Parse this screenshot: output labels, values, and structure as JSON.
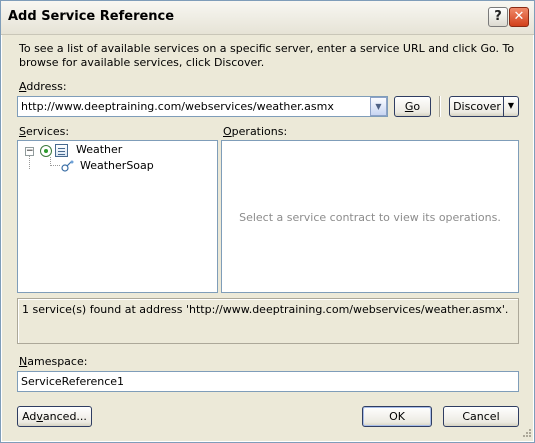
{
  "window": {
    "title": "Add Service Reference",
    "help_glyph": "?",
    "close_glyph": "✕"
  },
  "description": "To see a list of available services on a specific server, enter a service URL and click Go. To browse for available services, click Discover.",
  "address": {
    "label_mnemonic": "A",
    "label_rest": "ddress:",
    "value": "http://www.deeptraining.com/webservices/weather.asmx",
    "dropdown_glyph": "▼"
  },
  "buttons": {
    "go_mnemonic": "G",
    "go_rest": "o",
    "discover_label": "Discover",
    "discover_split_glyph": "▼",
    "advanced_before": "Ad",
    "advanced_mnemonic": "v",
    "advanced_after": "anced...",
    "ok_label": "OK",
    "cancel_label": "Cancel"
  },
  "services": {
    "label_mnemonic": "S",
    "label_rest": "ervices:",
    "expander_glyph": "−",
    "tree": [
      {
        "label": "Weather",
        "icon": "service-icon"
      },
      {
        "label": "WeatherSoap",
        "icon": "contract-icon"
      }
    ]
  },
  "operations": {
    "label_mnemonic": "O",
    "label_rest": "perations:",
    "placeholder": "Select a service contract to view its operations."
  },
  "status_message": "1 service(s) found at address 'http://www.deeptraining.com/webservices/weather.asmx'.",
  "namespace": {
    "label_mnemonic": "N",
    "label_rest": "amespace:",
    "value": "ServiceReference1"
  },
  "colors": {
    "dialog_background": "#ece9d8",
    "field_border": "#7f9db9",
    "close_button": "#d2401b",
    "placeholder_text": "#8c8c8c"
  }
}
